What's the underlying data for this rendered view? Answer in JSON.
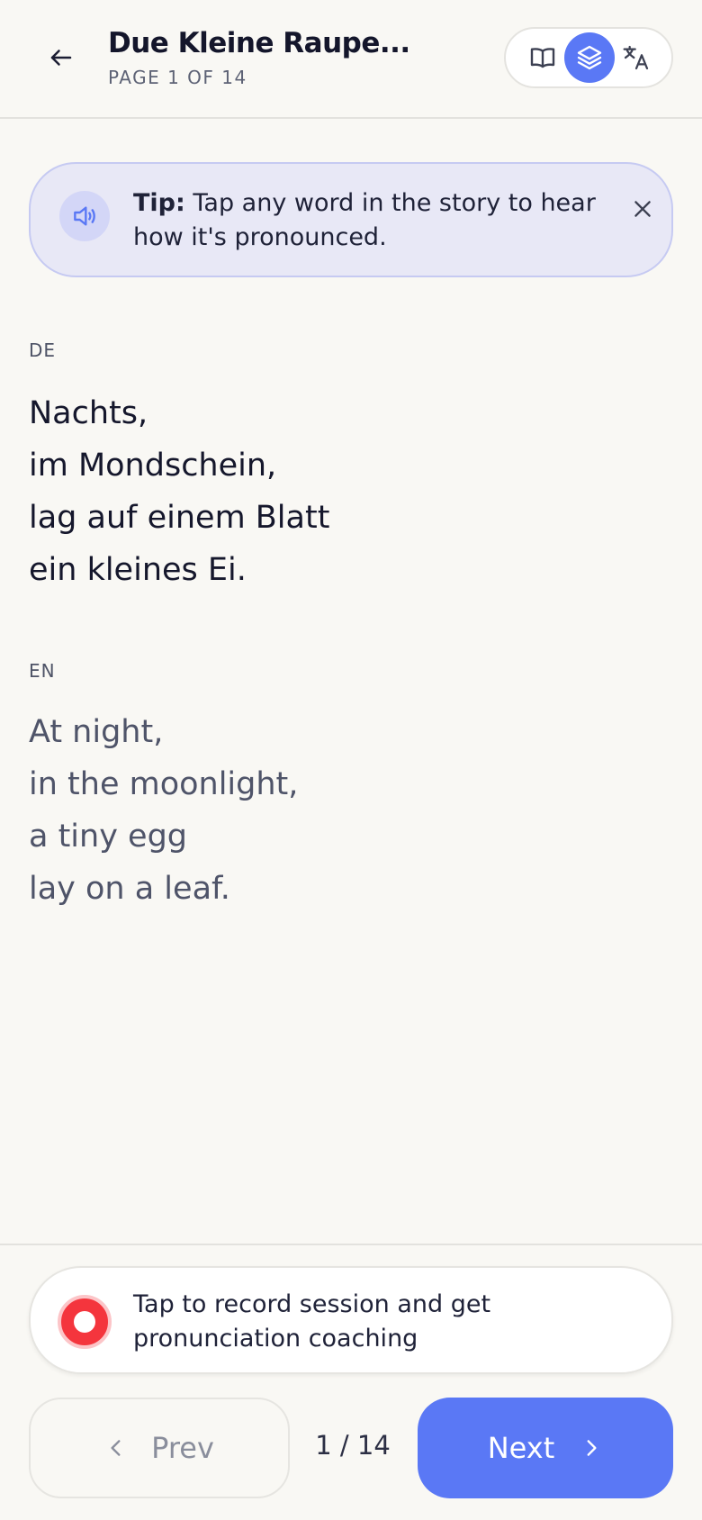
{
  "header": {
    "title": "Due Kleine Raupe...",
    "page_label": "PAGE 1 OF 14",
    "back_icon": "arrow-left-icon",
    "modes": [
      {
        "name": "read",
        "icon": "book-open-icon",
        "active": false
      },
      {
        "name": "layers",
        "icon": "layers-icon",
        "active": true
      },
      {
        "name": "translate",
        "icon": "translate-icon",
        "active": false
      }
    ]
  },
  "tip": {
    "bold": "Tip:",
    "text": " Tap any word in the story to hear how it's pronounced.",
    "icon": "speaker-icon",
    "close_icon": "close-icon"
  },
  "story": {
    "de": {
      "label": "DE",
      "lines": [
        "Nachts,",
        "im Mondschein,",
        "lag auf einem Blatt",
        "ein kleines Ei."
      ]
    },
    "en": {
      "label": "EN",
      "lines": [
        "At night,",
        "in the moonlight,",
        "a tiny egg",
        "lay on a leaf."
      ]
    }
  },
  "record": {
    "text": "Tap to record session and get pronunciation coaching",
    "icon": "record-icon"
  },
  "nav": {
    "prev_label": "Prev",
    "next_label": "Next",
    "counter": "1 / 14"
  },
  "colors": {
    "background": "#f9f8f4",
    "accent": "#5a78f5",
    "record_red": "#f4353d",
    "tip_background": "#e8e8f6"
  }
}
